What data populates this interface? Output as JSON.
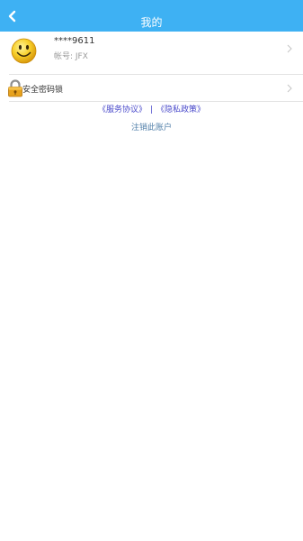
{
  "header": {
    "title": "我的",
    "back_icon": "chevron-left-icon",
    "background_color": "#3eb1f3"
  },
  "profile": {
    "avatar_icon": "smiley-face-icon",
    "username": "****9611",
    "account_label": "帐号: JFX"
  },
  "menu": {
    "security_lock_label": "安全密码锁",
    "security_lock_icon": "padlock-icon"
  },
  "links": {
    "service_agreement": "《服务协议》",
    "separator": "|",
    "privacy_policy": "《隐私政策》",
    "link_color": "#4a4acb"
  },
  "deregister_label": "注销此账户"
}
